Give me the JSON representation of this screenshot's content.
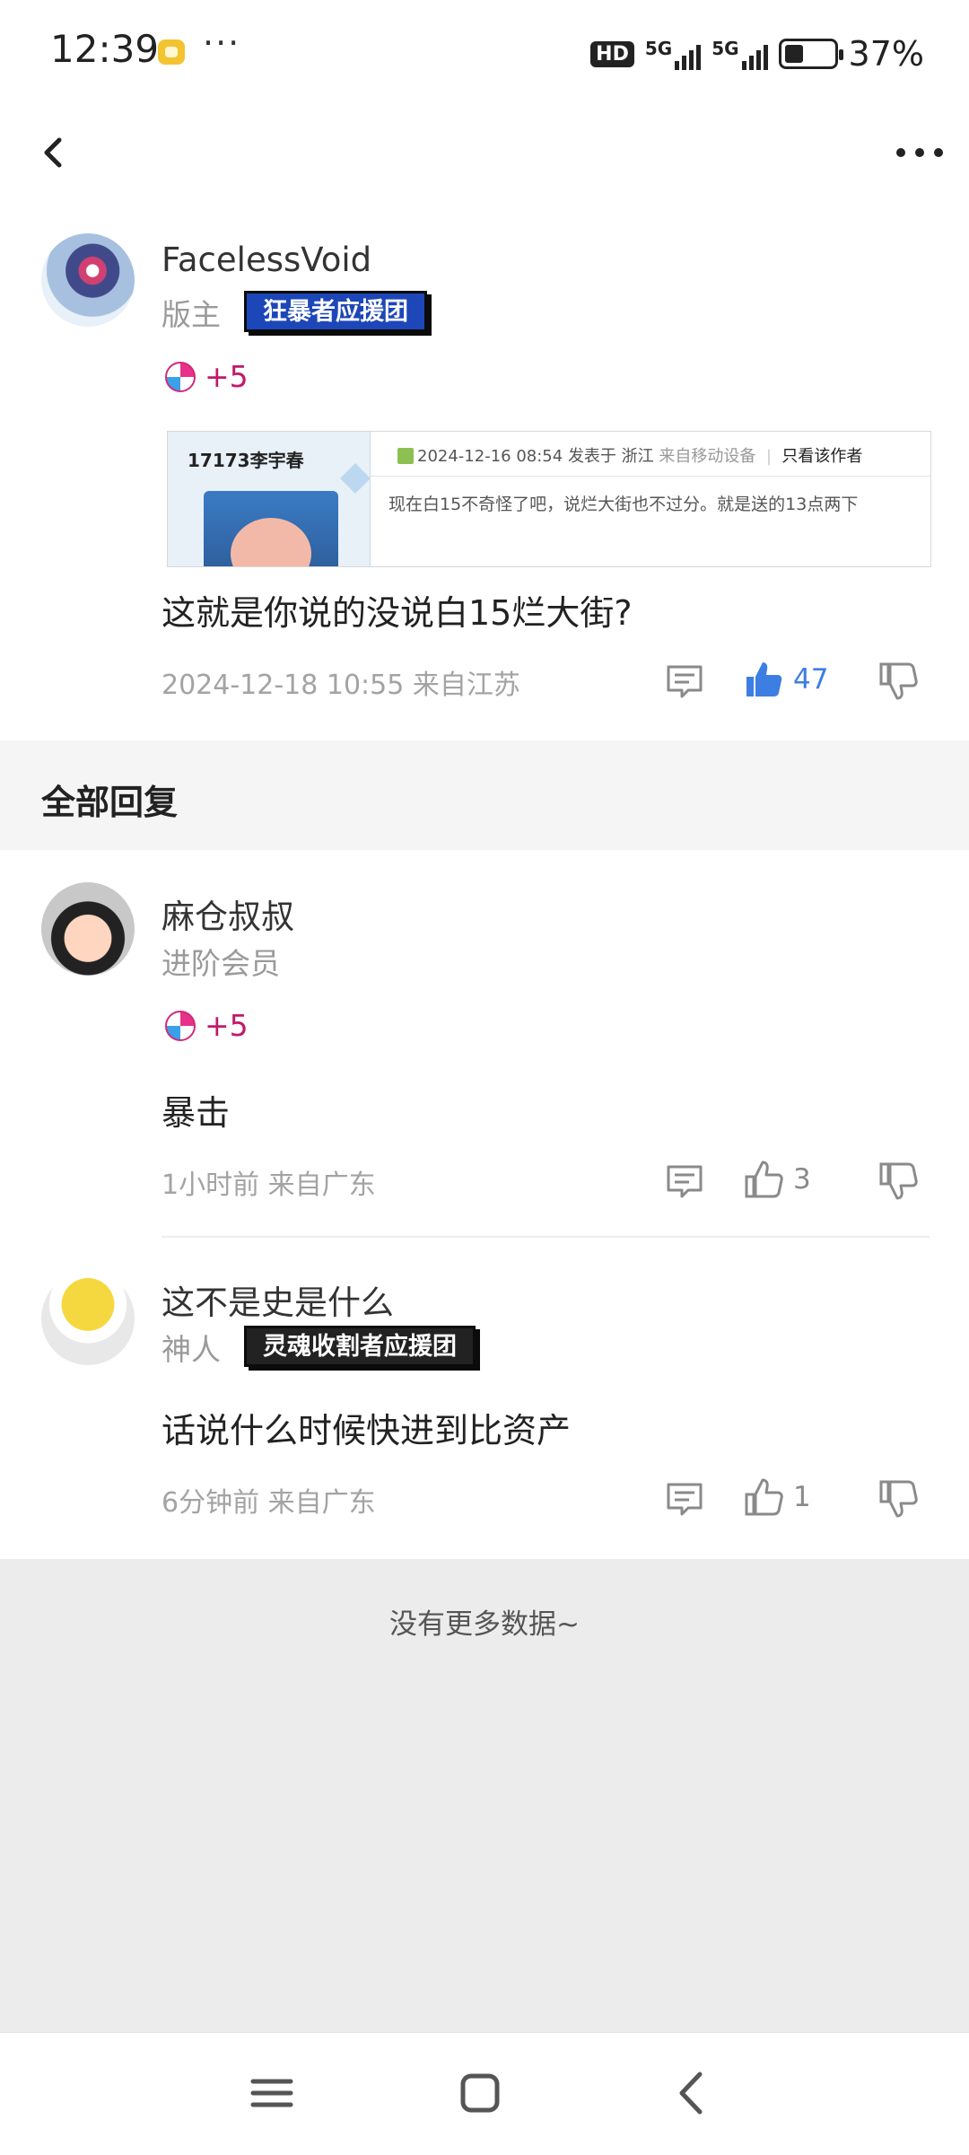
{
  "status_bar": {
    "time": "12:39",
    "dots": "···",
    "hd_label": "HD",
    "network_1": "5G",
    "network_2": "5G",
    "battery_text": "37%"
  },
  "post": {
    "username": "FacelessVoid",
    "role": "版主",
    "badge": "狂暴者应援团",
    "gift": "+5",
    "quote": {
      "author": "17173李宇春",
      "meta_date": "2024-12-16 08:54",
      "meta_location": "发表于 浙江",
      "meta_device": "来自移动设备",
      "meta_author_only": "只看该作者",
      "text": "现在白15不奇怪了吧，说烂大街也不过分。就是送的13点两下"
    },
    "text": "这就是你说的没说白15烂大街?",
    "timestamp": "2024-12-18 10:55  来自江苏",
    "likes": "47"
  },
  "section_title": "全部回复",
  "replies": [
    {
      "username": "麻仓叔叔",
      "role": "进阶会员",
      "gift": "+5",
      "text": "暴击",
      "timestamp": "1小时前 来自广东",
      "likes": "3"
    },
    {
      "username": "这不是史是什么",
      "role": "神人",
      "badge": "灵魂收割者应援团",
      "text": "话说什么时候快进到比资产",
      "timestamp": "6分钟前 来自广东",
      "likes": "1"
    }
  ],
  "no_more": "没有更多数据~",
  "colors": {
    "accent_blue": "#3d7ee3",
    "gift_pink": "#c01a6a",
    "badge_blue": "#1d47b8"
  }
}
